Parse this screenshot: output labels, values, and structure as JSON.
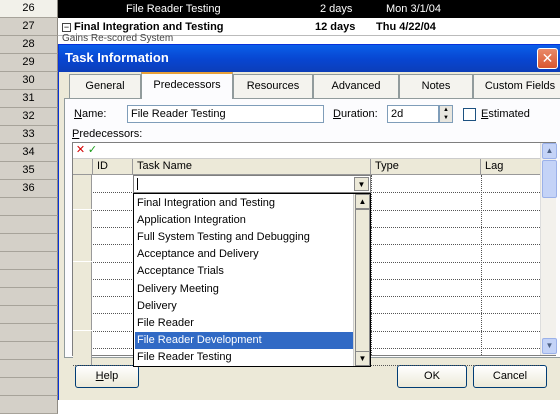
{
  "background": {
    "row_numbers": [
      "26",
      "27",
      "28",
      "29",
      "30",
      "31",
      "32",
      "33",
      "34",
      "35",
      "36"
    ],
    "row26": {
      "name": "File Reader Testing",
      "duration": "2 days",
      "start": "Mon 3/1/04"
    },
    "row27": {
      "collapse_glyph": "−",
      "name": "Final Integration and Testing",
      "duration": "12 days",
      "start": "Thu 4/22/04"
    },
    "faint_text": "Gains   Re-scored System"
  },
  "dialog": {
    "title": "Task Information",
    "close_glyph": "✕",
    "tabs": [
      {
        "label": "General"
      },
      {
        "label": "Predecessors"
      },
      {
        "label": "Resources"
      },
      {
        "label": "Advanced"
      },
      {
        "label": "Notes"
      },
      {
        "label": "Custom Fields"
      }
    ],
    "active_tab": "Predecessors",
    "name_label_u": "N",
    "name_label_rest": "ame:",
    "name_value": "File Reader Testing",
    "duration_label_u": "D",
    "duration_label_rest": "uration:",
    "duration_value": "2d",
    "estimated_label_u": "E",
    "estimated_label_rest": "stimated",
    "estimated_checked": false,
    "predecessors_label_u": "P",
    "predecessors_label_rest": "redecessors:",
    "grid": {
      "cancel_glyph": "✕",
      "accept_glyph": "✓",
      "columns": [
        {
          "label": "ID"
        },
        {
          "label": "Task Name"
        },
        {
          "label": "Type"
        },
        {
          "label": "Lag"
        }
      ],
      "task_name_input": ""
    },
    "dropdown": {
      "arrow_glyph": "▼",
      "scroll_up_glyph": "▲",
      "scroll_down_glyph": "▼",
      "items": [
        "Final Integration and Testing",
        "Application Integration",
        "Full System Testing and Debugging",
        "Acceptance and Delivery",
        "Acceptance Trials",
        "Delivery Meeting",
        "Delivery",
        "File Reader",
        "File Reader Development",
        "File Reader Testing"
      ],
      "selected_item": "File Reader Development"
    },
    "grid_scroll": {
      "up_glyph": "▲",
      "down_glyph": "▼"
    },
    "buttons": {
      "help_u": "H",
      "help_rest": "elp",
      "ok": "OK",
      "cancel": "Cancel"
    }
  },
  "colors": {
    "titlebar": "#0845d0",
    "selection": "#316ac5",
    "active_tab_accent": "#e7a13b",
    "cancel_icon": "#d40000",
    "accept_icon": "#1a9c1a"
  }
}
